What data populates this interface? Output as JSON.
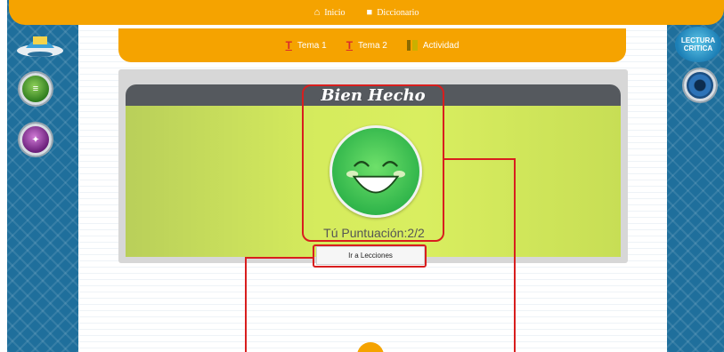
{
  "topbar": {
    "items": [
      {
        "label": "Inicio",
        "icon": "home-icon"
      },
      {
        "label": "Diccionario",
        "icon": "book-icon"
      }
    ]
  },
  "subbar": {
    "items": [
      {
        "label": "Tema 1",
        "icon": "tema-icon"
      },
      {
        "label": "Tema 2",
        "icon": "tema-icon"
      },
      {
        "label": "Actividad",
        "icon": "activity-icon"
      }
    ]
  },
  "right_panel": {
    "lectura_line1": "LECTURA",
    "lectura_line2": "CRITICA"
  },
  "card": {
    "title": "Bien Hecho",
    "score_text": "Tú Puntuación:2/2",
    "lessons_button": "Ir a Lecciones"
  },
  "colors": {
    "accent_orange": "#f5a300",
    "panel_blue": "#1f6f9c",
    "card_green": "#d6ec5d",
    "annotation_red": "#d81e1e"
  }
}
